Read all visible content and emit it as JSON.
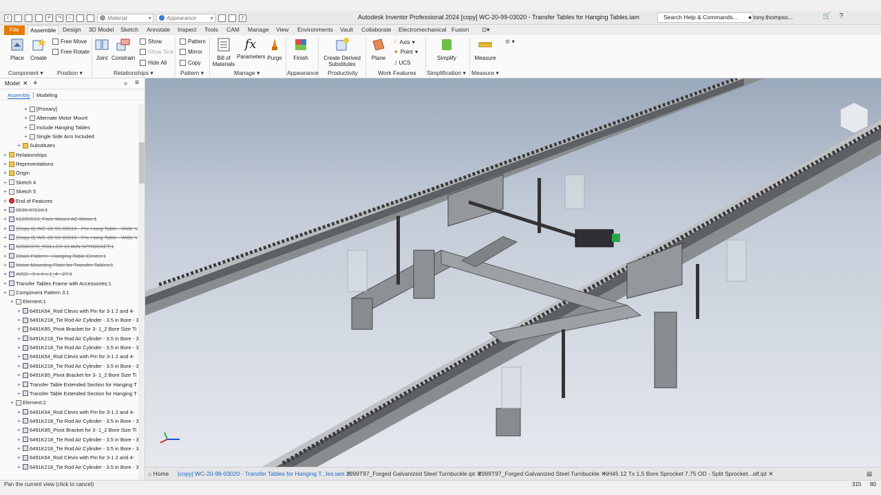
{
  "titlebar": {
    "material": "Material",
    "appearance": "Appearance",
    "window_title": "Autodesk Inventor Professional 2024   [copy] WC-20-99-03020 - Transfer Tables for Hanging Tables.iam",
    "search": "Search Help & Commands...",
    "user": "tony.thompso..."
  },
  "menubar": {
    "tabs": [
      "File",
      "Assemble",
      "Design",
      "3D Model",
      "Sketch",
      "Annotate",
      "Inspect",
      "Tools",
      "CAM",
      "Manage",
      "View",
      "Environments",
      "Vault",
      "Collaborate",
      "Electromechanical",
      "Fusion"
    ],
    "active": "Assemble"
  },
  "ribbon": {
    "place": "Place",
    "create": "Create",
    "free_move": "Free Move",
    "free_rotate": "Free Rotate",
    "joint": "Joint",
    "constrain": "Constrain",
    "show": "Show",
    "show_sick": "Show Sick",
    "hide_all": "Hide All",
    "pattern": "Pattern",
    "mirror": "Mirror",
    "copy": "Copy",
    "bom1": "Bill of",
    "bom2": "Materials",
    "parameters": "Parameters",
    "purge": "Purge",
    "finish": "Finish",
    "create_derived1": "Create Derived",
    "create_derived2": "Substitutes",
    "plane": "Plane",
    "axis": "Axis",
    "point": "Point",
    "ucs": "UCS",
    "simplify": "Simplify",
    "measure": "Measure",
    "groups": [
      "Component",
      "Position",
      "Relationships",
      "Pattern",
      "Manage",
      "Appearance",
      "Productivity",
      "Work Features",
      "Simplification",
      "Measure"
    ]
  },
  "browser": {
    "tab": "Model",
    "sub_tabs": [
      "Assembly",
      "Modeling"
    ],
    "items": [
      {
        "label": "[Primary]",
        "indent": 3,
        "icon": "grid",
        "strike": false
      },
      {
        "label": "Alternate Motor Mount",
        "indent": 3,
        "icon": "grid",
        "strike": false
      },
      {
        "label": "Include Hanging Tables",
        "indent": 3,
        "icon": "grid",
        "strike": false
      },
      {
        "label": "Single Side Arm Included",
        "indent": 3,
        "icon": "grid",
        "strike": false
      },
      {
        "label": "Substitutes",
        "indent": 2,
        "icon": "fold",
        "strike": false
      },
      {
        "label": "Relationships",
        "indent": 0,
        "icon": "fold",
        "strike": false
      },
      {
        "label": "Representations",
        "indent": 0,
        "icon": "fold",
        "strike": false
      },
      {
        "label": "Origin",
        "indent": 0,
        "icon": "fold",
        "strike": false
      },
      {
        "label": "Sketch 4",
        "indent": 0,
        "icon": "grid",
        "strike": false
      },
      {
        "label": "Sketch 5",
        "indent": 0,
        "icon": "grid",
        "strike": false
      },
      {
        "label": "End of Features",
        "indent": 0,
        "icon": "red",
        "strike": false
      },
      {
        "label": "0230-07210:1",
        "indent": 0,
        "icon": "part",
        "strike": true
      },
      {
        "label": "6135K513_Face Mount AC Motor:1",
        "indent": 0,
        "icon": "part",
        "strike": true
      },
      {
        "label": "(Copy 8) WC-20-99-03016 - Pre Hang Table - Wide V",
        "indent": 0,
        "icon": "part",
        "strike": true
      },
      {
        "label": "(Copy 8) WC-20-99-03016 - Pre Hang Table - Wide V",
        "indent": 0,
        "icon": "part",
        "strike": true
      },
      {
        "label": "6280K378_ROLLER CHAIN SPROCKET:1",
        "indent": 0,
        "icon": "part",
        "strike": true
      },
      {
        "label": "Chain Pattern - Hanging Table Center:1",
        "indent": 0,
        "icon": "part",
        "strike": true
      },
      {
        "label": "Motor Mounting Plate for Transfer Tables:1",
        "indent": 0,
        "icon": "part",
        "strike": true
      },
      {
        "label": "AISC - 6 x 4 x 1_4 - 27:1",
        "indent": 0,
        "icon": "part",
        "strike": true
      },
      {
        "label": "Transfer Tables Frame with Accessories:1",
        "indent": 0,
        "icon": "part",
        "strike": false
      },
      {
        "label": "Component Pattern 3:1",
        "indent": 0,
        "icon": "grid",
        "strike": false
      },
      {
        "label": "Element:1",
        "indent": 1,
        "icon": "grid",
        "strike": false
      },
      {
        "label": "6491K64_Rod Clevis with Pin for 3-1 2  and 4-",
        "indent": 2,
        "icon": "part",
        "strike": false
      },
      {
        "label": "6491K218_Tie Rod Air Cylinder - 3.5 in Bore - 3",
        "indent": 2,
        "icon": "part",
        "strike": false
      },
      {
        "label": "6491K85_Pivot Bracket for 3- 1_2  Bore Size Ti",
        "indent": 2,
        "icon": "part",
        "strike": false
      },
      {
        "label": "6491K218_Tie Rod Air Cylinder - 3.5 in Bore - 3",
        "indent": 2,
        "icon": "part",
        "strike": false
      },
      {
        "label": "6491K218_Tie Rod Air Cylinder - 3.5 in Bore - 3",
        "indent": 2,
        "icon": "part",
        "strike": false
      },
      {
        "label": "6491K64_Rod Clevis with Pin for 3-1 2  and 4-",
        "indent": 2,
        "icon": "part",
        "strike": false
      },
      {
        "label": "6491K218_Tie Rod Air Cylinder - 3.5 in Bore - 3",
        "indent": 2,
        "icon": "part",
        "strike": false
      },
      {
        "label": "6491K85_Pivot Bracket for 3- 1_2  Bore Size Ti",
        "indent": 2,
        "icon": "part",
        "strike": false
      },
      {
        "label": "Transfer Table Extended Section for Hanging T",
        "indent": 2,
        "icon": "part",
        "strike": false
      },
      {
        "label": "Transfer Table Extended Section for Hanging T",
        "indent": 2,
        "icon": "part",
        "strike": false
      },
      {
        "label": "Element:2",
        "indent": 1,
        "icon": "grid",
        "strike": false
      },
      {
        "label": "6491K64_Rod Clevis with Pin for 3-1 2  and 4-",
        "indent": 2,
        "icon": "part",
        "strike": false
      },
      {
        "label": "6491K218_Tie Rod Air Cylinder - 3.5 in Bore - 3",
        "indent": 2,
        "icon": "part",
        "strike": false
      },
      {
        "label": "6491K85_Pivot Bracket for 3- 1_2  Bore Size Ti",
        "indent": 2,
        "icon": "part",
        "strike": false
      },
      {
        "label": "6491K218_Tie Rod Air Cylinder - 3.5 in Bore - 3",
        "indent": 2,
        "icon": "part",
        "strike": false
      },
      {
        "label": "6491K218_Tie Rod Air Cylinder - 3.5 in Bore - 3",
        "indent": 2,
        "icon": "part",
        "strike": false
      },
      {
        "label": "6491K64_Rod Clevis with Pin for 3-1 2  and 4-",
        "indent": 2,
        "icon": "part",
        "strike": false
      },
      {
        "label": "6491K218_Tie Rod Air Cylinder - 3.5 in Bore - 3",
        "indent": 2,
        "icon": "part",
        "strike": false
      }
    ]
  },
  "doc_tabs": {
    "home": "Home",
    "tabs": [
      "[copy] WC-20-99-03020 - Transfer Tables for Hanging T...les.iam",
      "2999T97_Forged Galvanized Steel Turnbuckle.ipt",
      "2999T97_Forged Galvanized Steel Turnbuckle",
      "NH45  12 Tx 1.5 Bore Sprocket 7.75 OD - Split Sprocket...alf.ipt"
    ]
  },
  "status": {
    "message": "Pan the current view (click to cancel)",
    "count1": "315",
    "count2": "80"
  }
}
